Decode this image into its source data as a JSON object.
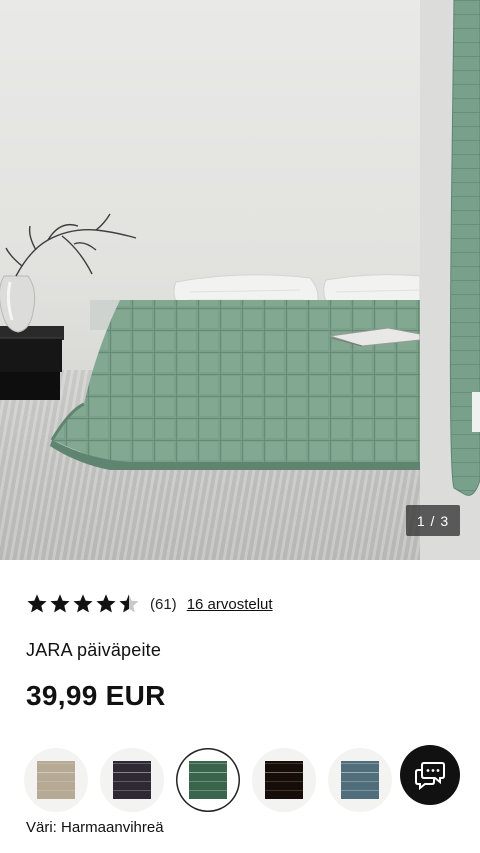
{
  "gallery": {
    "counter": "1 / 3",
    "current_slide": 1,
    "total_slides": 3,
    "product_color": "#7aa08a"
  },
  "rating": {
    "stars": 4.5,
    "max_stars": 5,
    "count_text": "(61)",
    "reviews_link": "16 arvostelut"
  },
  "product": {
    "title": "JARA päiväpeite",
    "price": "39,99 EUR"
  },
  "swatches": [
    {
      "name": "beige",
      "color": "#d8d0c2",
      "selected": false
    },
    {
      "name": "purple-grey",
      "color": "#6d6673",
      "selected": false
    },
    {
      "name": "grey-green",
      "color": "#7aa08a",
      "selected": true
    },
    {
      "name": "dark-brown",
      "color": "#4a3a2f",
      "selected": false
    },
    {
      "name": "blue-grey",
      "color": "#8fa7b2",
      "selected": false
    }
  ],
  "chat": {
    "icon": "chat-bubbles-icon"
  },
  "color_label": "Väri: Harmaanvihreä"
}
